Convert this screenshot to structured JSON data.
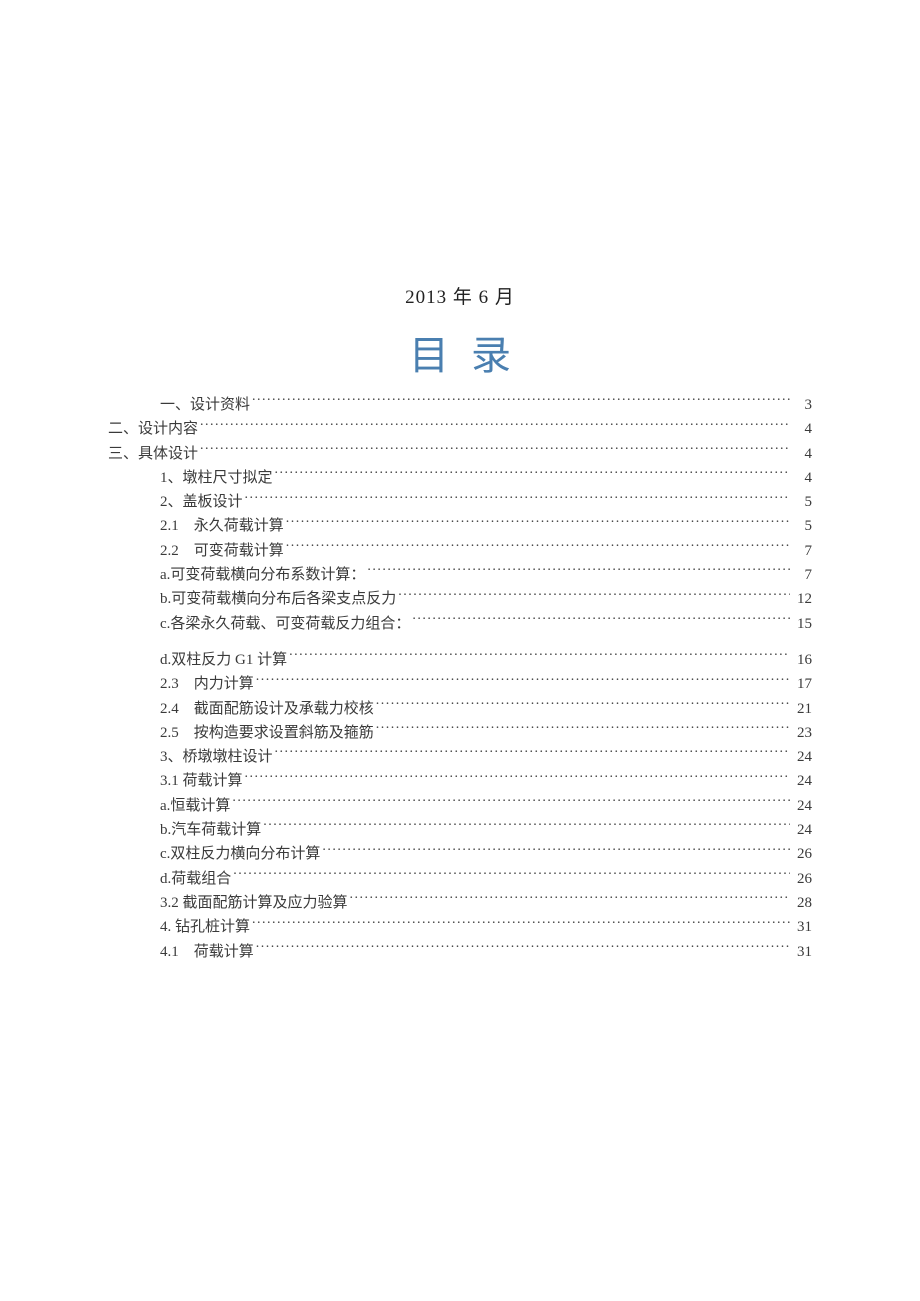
{
  "date": "2013 年 6 月",
  "title": "目录",
  "toc": [
    {
      "label": "一、设计资料",
      "page": "3",
      "indent": "indent-0"
    },
    {
      "label": "二、设计内容",
      "page": "4",
      "indent": "indent-0b"
    },
    {
      "label": "三、具体设计",
      "page": "4",
      "indent": "indent-0b"
    },
    {
      "label": "1、墩柱尺寸拟定",
      "page": "4",
      "indent": "indent-1"
    },
    {
      "label": "2、盖板设计",
      "page": "5",
      "indent": "indent-1"
    },
    {
      "label": "2.1　永久荷载计算",
      "page": "5",
      "indent": "indent-2"
    },
    {
      "label": "2.2　可变荷载计算",
      "page": "7",
      "indent": "indent-2"
    },
    {
      "label": "a.可变荷载横向分布系数计算：",
      "page": "7",
      "indent": "indent-2"
    },
    {
      "label": "b.可变荷载横向分布后各梁支点反力",
      "page": "12",
      "indent": "indent-2"
    },
    {
      "label": "c.各梁永久荷载、可变荷载反力组合：",
      "page": "15",
      "indent": "indent-2"
    },
    {
      "gap": true
    },
    {
      "label": "d.双柱反力 G1 计算",
      "page": "16",
      "indent": "indent-2"
    },
    {
      "label": "2.3　内力计算",
      "page": "17",
      "indent": "indent-2"
    },
    {
      "label": "2.4　截面配筋设计及承载力校核",
      "page": "21",
      "indent": "indent-2"
    },
    {
      "label": "2.5　按构造要求设置斜筋及箍筋",
      "page": "23",
      "indent": "indent-2"
    },
    {
      "label": "3、桥墩墩柱设计",
      "page": "24",
      "indent": "indent-1"
    },
    {
      "label": "3.1 荷载计算",
      "page": "24",
      "indent": "indent-2"
    },
    {
      "label": "a.恒载计算",
      "page": "24",
      "indent": "indent-2"
    },
    {
      "label": "b.汽车荷载计算",
      "page": "24",
      "indent": "indent-2"
    },
    {
      "label": "c.双柱反力横向分布计算",
      "page": "26",
      "indent": "indent-2"
    },
    {
      "label": "d.荷载组合",
      "page": "26",
      "indent": "indent-2"
    },
    {
      "label": "3.2 截面配筋计算及应力验算",
      "page": "28",
      "indent": "indent-2"
    },
    {
      "label": "4. 钻孔桩计算",
      "page": "31",
      "indent": "indent-1"
    },
    {
      "label": "4.1　荷载计算",
      "page": "31",
      "indent": "indent-2"
    }
  ]
}
